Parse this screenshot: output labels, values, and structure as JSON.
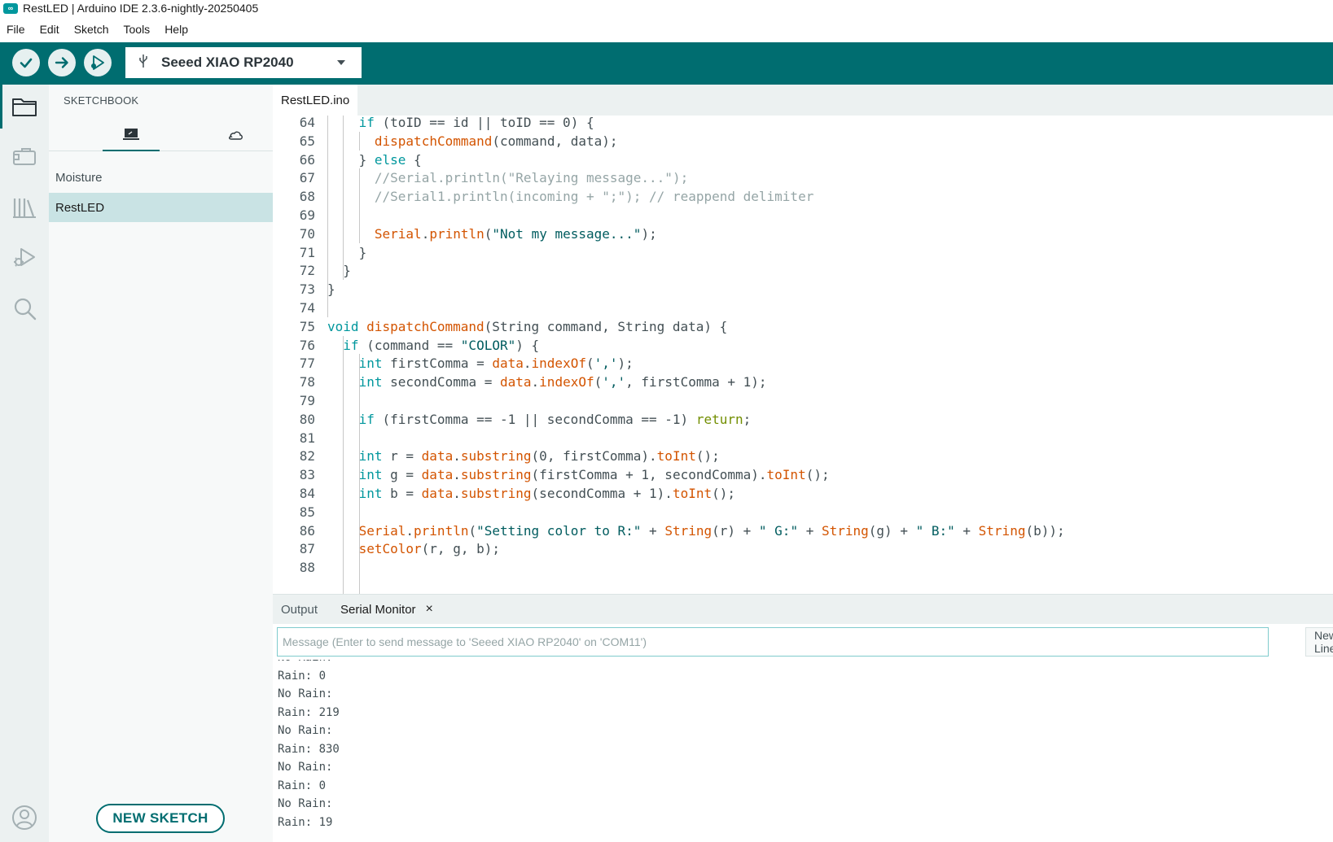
{
  "window": {
    "title": "RestLED | Arduino IDE 2.3.6-nightly-20250405",
    "icon": "infinity-logo-icon"
  },
  "menu": [
    "File",
    "Edit",
    "Sketch",
    "Tools",
    "Help"
  ],
  "toolbar": {
    "verify_icon": "check-icon",
    "upload_icon": "arrow-right-icon",
    "debug_icon": "debug-play-icon",
    "board": "Seeed XIAO RP2040",
    "usb_icon": "usb-icon",
    "dropdown_icon": "caret-down-icon"
  },
  "activity_icons": [
    "folder-icon",
    "board-icon",
    "library-icon",
    "debug-icon",
    "search-icon",
    "account-icon"
  ],
  "sidebar": {
    "heading": "SKETCHBOOK",
    "tabs": [
      {
        "icon": "laptop-icon",
        "active": true
      },
      {
        "icon": "cloud-icon",
        "active": false
      }
    ],
    "items": [
      {
        "label": "Moisture",
        "selected": false
      },
      {
        "label": "RestLED",
        "selected": true
      }
    ],
    "new_sketch": "NEW SKETCH"
  },
  "editor": {
    "tab": "RestLED.ino",
    "lines": [
      {
        "n": "64",
        "indent": 2,
        "tokens": [
          [
            "kw",
            "if"
          ],
          [
            "nm",
            " (toID == id || toID == "
          ],
          [
            "nm",
            "0"
          ],
          [
            "nm",
            ") {"
          ]
        ]
      },
      {
        "n": "65",
        "indent": 3,
        "tokens": [
          [
            "fn",
            "dispatchCommand"
          ],
          [
            "nm",
            "(command, data);"
          ]
        ]
      },
      {
        "n": "66",
        "indent": 2,
        "tokens": [
          [
            "nm",
            "} "
          ],
          [
            "kw",
            "else"
          ],
          [
            "nm",
            " {"
          ]
        ]
      },
      {
        "n": "67",
        "indent": 3,
        "tokens": [
          [
            "cm",
            "//Serial.println(\"Relaying message...\");"
          ]
        ]
      },
      {
        "n": "68",
        "indent": 3,
        "tokens": [
          [
            "cm",
            "//Serial1.println(incoming + \";\"); // reappend delimiter"
          ]
        ]
      },
      {
        "n": "69",
        "indent": 3,
        "tokens": []
      },
      {
        "n": "70",
        "indent": 3,
        "tokens": [
          [
            "fn",
            "Serial"
          ],
          [
            "nm",
            "."
          ],
          [
            "fn",
            "println"
          ],
          [
            "nm",
            "("
          ],
          [
            "st",
            "\"Not my message...\""
          ],
          [
            "nm",
            ");"
          ]
        ]
      },
      {
        "n": "71",
        "indent": 2,
        "tokens": [
          [
            "nm",
            "}"
          ]
        ]
      },
      {
        "n": "72",
        "indent": 1,
        "tokens": [
          [
            "nm",
            "}"
          ]
        ]
      },
      {
        "n": "73",
        "indent": 0,
        "tokens": [
          [
            "nm",
            "}"
          ]
        ]
      },
      {
        "n": "74",
        "indent": 0,
        "tokens": []
      },
      {
        "n": "75",
        "indent": 0,
        "tokens": [
          [
            "ty",
            "void"
          ],
          [
            "nm",
            " "
          ],
          [
            "fn",
            "dispatchCommand"
          ],
          [
            "nm",
            "(String command, String data) {"
          ]
        ]
      },
      {
        "n": "76",
        "indent": 1,
        "tokens": [
          [
            "kw",
            "if"
          ],
          [
            "nm",
            " (command == "
          ],
          [
            "st",
            "\"COLOR\""
          ],
          [
            "nm",
            ") {"
          ]
        ]
      },
      {
        "n": "77",
        "indent": 2,
        "tokens": [
          [
            "ty",
            "int"
          ],
          [
            "nm",
            " firstComma = "
          ],
          [
            "fn",
            "data"
          ],
          [
            "nm",
            "."
          ],
          [
            "fn",
            "indexOf"
          ],
          [
            "nm",
            "("
          ],
          [
            "st",
            "','"
          ],
          [
            "nm",
            ");"
          ]
        ]
      },
      {
        "n": "78",
        "indent": 2,
        "tokens": [
          [
            "ty",
            "int"
          ],
          [
            "nm",
            " secondComma = "
          ],
          [
            "fn",
            "data"
          ],
          [
            "nm",
            "."
          ],
          [
            "fn",
            "indexOf"
          ],
          [
            "nm",
            "("
          ],
          [
            "st",
            "','"
          ],
          [
            "nm",
            ", firstComma + "
          ],
          [
            "nm",
            "1"
          ],
          [
            "nm",
            ");"
          ]
        ]
      },
      {
        "n": "79",
        "indent": 2,
        "tokens": []
      },
      {
        "n": "80",
        "indent": 2,
        "tokens": [
          [
            "kw",
            "if"
          ],
          [
            "nm",
            " (firstComma == -1 || secondComma == -1) "
          ],
          [
            "rt",
            "return"
          ],
          [
            "nm",
            ";"
          ]
        ]
      },
      {
        "n": "81",
        "indent": 2,
        "tokens": []
      },
      {
        "n": "82",
        "indent": 2,
        "tokens": [
          [
            "ty",
            "int"
          ],
          [
            "nm",
            " r = "
          ],
          [
            "fn",
            "data"
          ],
          [
            "nm",
            "."
          ],
          [
            "fn",
            "substring"
          ],
          [
            "nm",
            "(0, firstComma)."
          ],
          [
            "fn",
            "toInt"
          ],
          [
            "nm",
            "();"
          ]
        ]
      },
      {
        "n": "83",
        "indent": 2,
        "tokens": [
          [
            "ty",
            "int"
          ],
          [
            "nm",
            " g = "
          ],
          [
            "fn",
            "data"
          ],
          [
            "nm",
            "."
          ],
          [
            "fn",
            "substring"
          ],
          [
            "nm",
            "(firstComma + 1, secondComma)."
          ],
          [
            "fn",
            "toInt"
          ],
          [
            "nm",
            "();"
          ]
        ]
      },
      {
        "n": "84",
        "indent": 2,
        "tokens": [
          [
            "ty",
            "int"
          ],
          [
            "nm",
            " b = "
          ],
          [
            "fn",
            "data"
          ],
          [
            "nm",
            "."
          ],
          [
            "fn",
            "substring"
          ],
          [
            "nm",
            "(secondComma + 1)."
          ],
          [
            "fn",
            "toInt"
          ],
          [
            "nm",
            "();"
          ]
        ]
      },
      {
        "n": "85",
        "indent": 2,
        "tokens": []
      },
      {
        "n": "86",
        "indent": 2,
        "tokens": [
          [
            "fn",
            "Serial"
          ],
          [
            "nm",
            "."
          ],
          [
            "fn",
            "println"
          ],
          [
            "nm",
            "("
          ],
          [
            "st",
            "\"Setting color to R:\""
          ],
          [
            "nm",
            " + "
          ],
          [
            "fn",
            "String"
          ],
          [
            "nm",
            "(r) + "
          ],
          [
            "st",
            "\" G:\""
          ],
          [
            "nm",
            " + "
          ],
          [
            "fn",
            "String"
          ],
          [
            "nm",
            "(g) + "
          ],
          [
            "st",
            "\" B:\""
          ],
          [
            "nm",
            " + "
          ],
          [
            "fn",
            "String"
          ],
          [
            "nm",
            "(b));"
          ]
        ]
      },
      {
        "n": "87",
        "indent": 2,
        "tokens": [
          [
            "fn",
            "setColor"
          ],
          [
            "nm",
            "(r, g, b);"
          ]
        ]
      },
      {
        "n": "88",
        "indent": 2,
        "tokens": []
      }
    ]
  },
  "panel": {
    "tabs": [
      {
        "label": "Output",
        "active": false
      },
      {
        "label": "Serial Monitor",
        "active": true,
        "close": "×"
      }
    ],
    "message_placeholder": "Message (Enter to send message to 'Seeed XIAO RP2040' on 'COM11')",
    "line_ending": "New Line",
    "serial_lines": [
      "No Rain:",
      "Rain: 0",
      "No Rain:",
      "Rain: 219",
      "No Rain:",
      "Rain: 830",
      "No Rain:",
      "Rain: 0",
      "No Rain:",
      "Rain: 19"
    ]
  }
}
